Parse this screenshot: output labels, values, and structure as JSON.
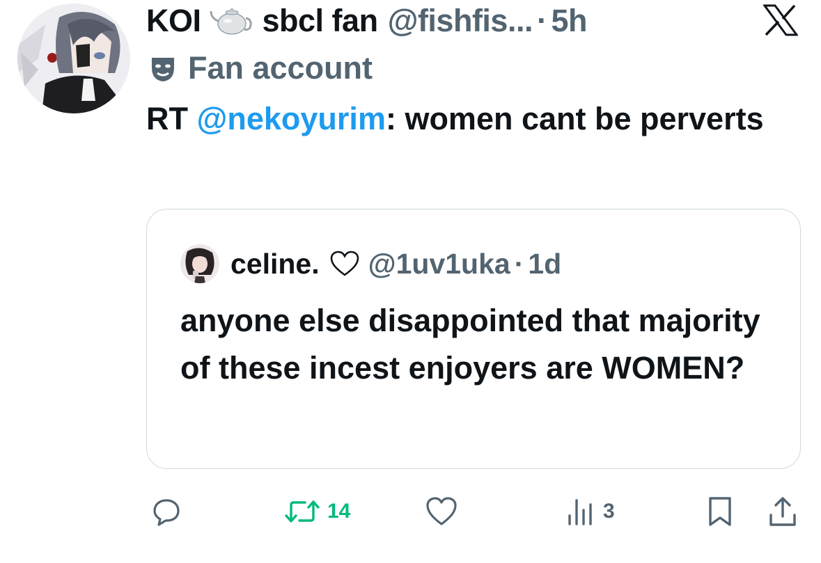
{
  "tweet": {
    "display_name": "KOI",
    "name_suffix": "sbcl fan",
    "handle": "@fishfis...",
    "separator": "·",
    "time": "5h",
    "account_label": "Fan account",
    "text_prefix": "RT ",
    "mention": "@nekoyurim",
    "text_suffix": ": women cant be perverts"
  },
  "quoted": {
    "display_name": "celine.",
    "handle": "@1uv1uka",
    "separator": "·",
    "time": "1d",
    "text": "anyone else disappointed that majority of these incest enjoyers are WOMEN?"
  },
  "actions": {
    "reply_icon": "reply-icon",
    "retweet_icon": "retweet-icon",
    "retweet_count": "14",
    "like_icon": "heart-icon",
    "views_icon": "views-icon",
    "views_count": "3",
    "bookmark_icon": "bookmark-icon",
    "share_icon": "share-icon"
  },
  "colors": {
    "text": "#0f1419",
    "secondary": "#536471",
    "mention": "#1d9bf0",
    "retweet": "#00ba7c",
    "border": "#cfd9de"
  }
}
